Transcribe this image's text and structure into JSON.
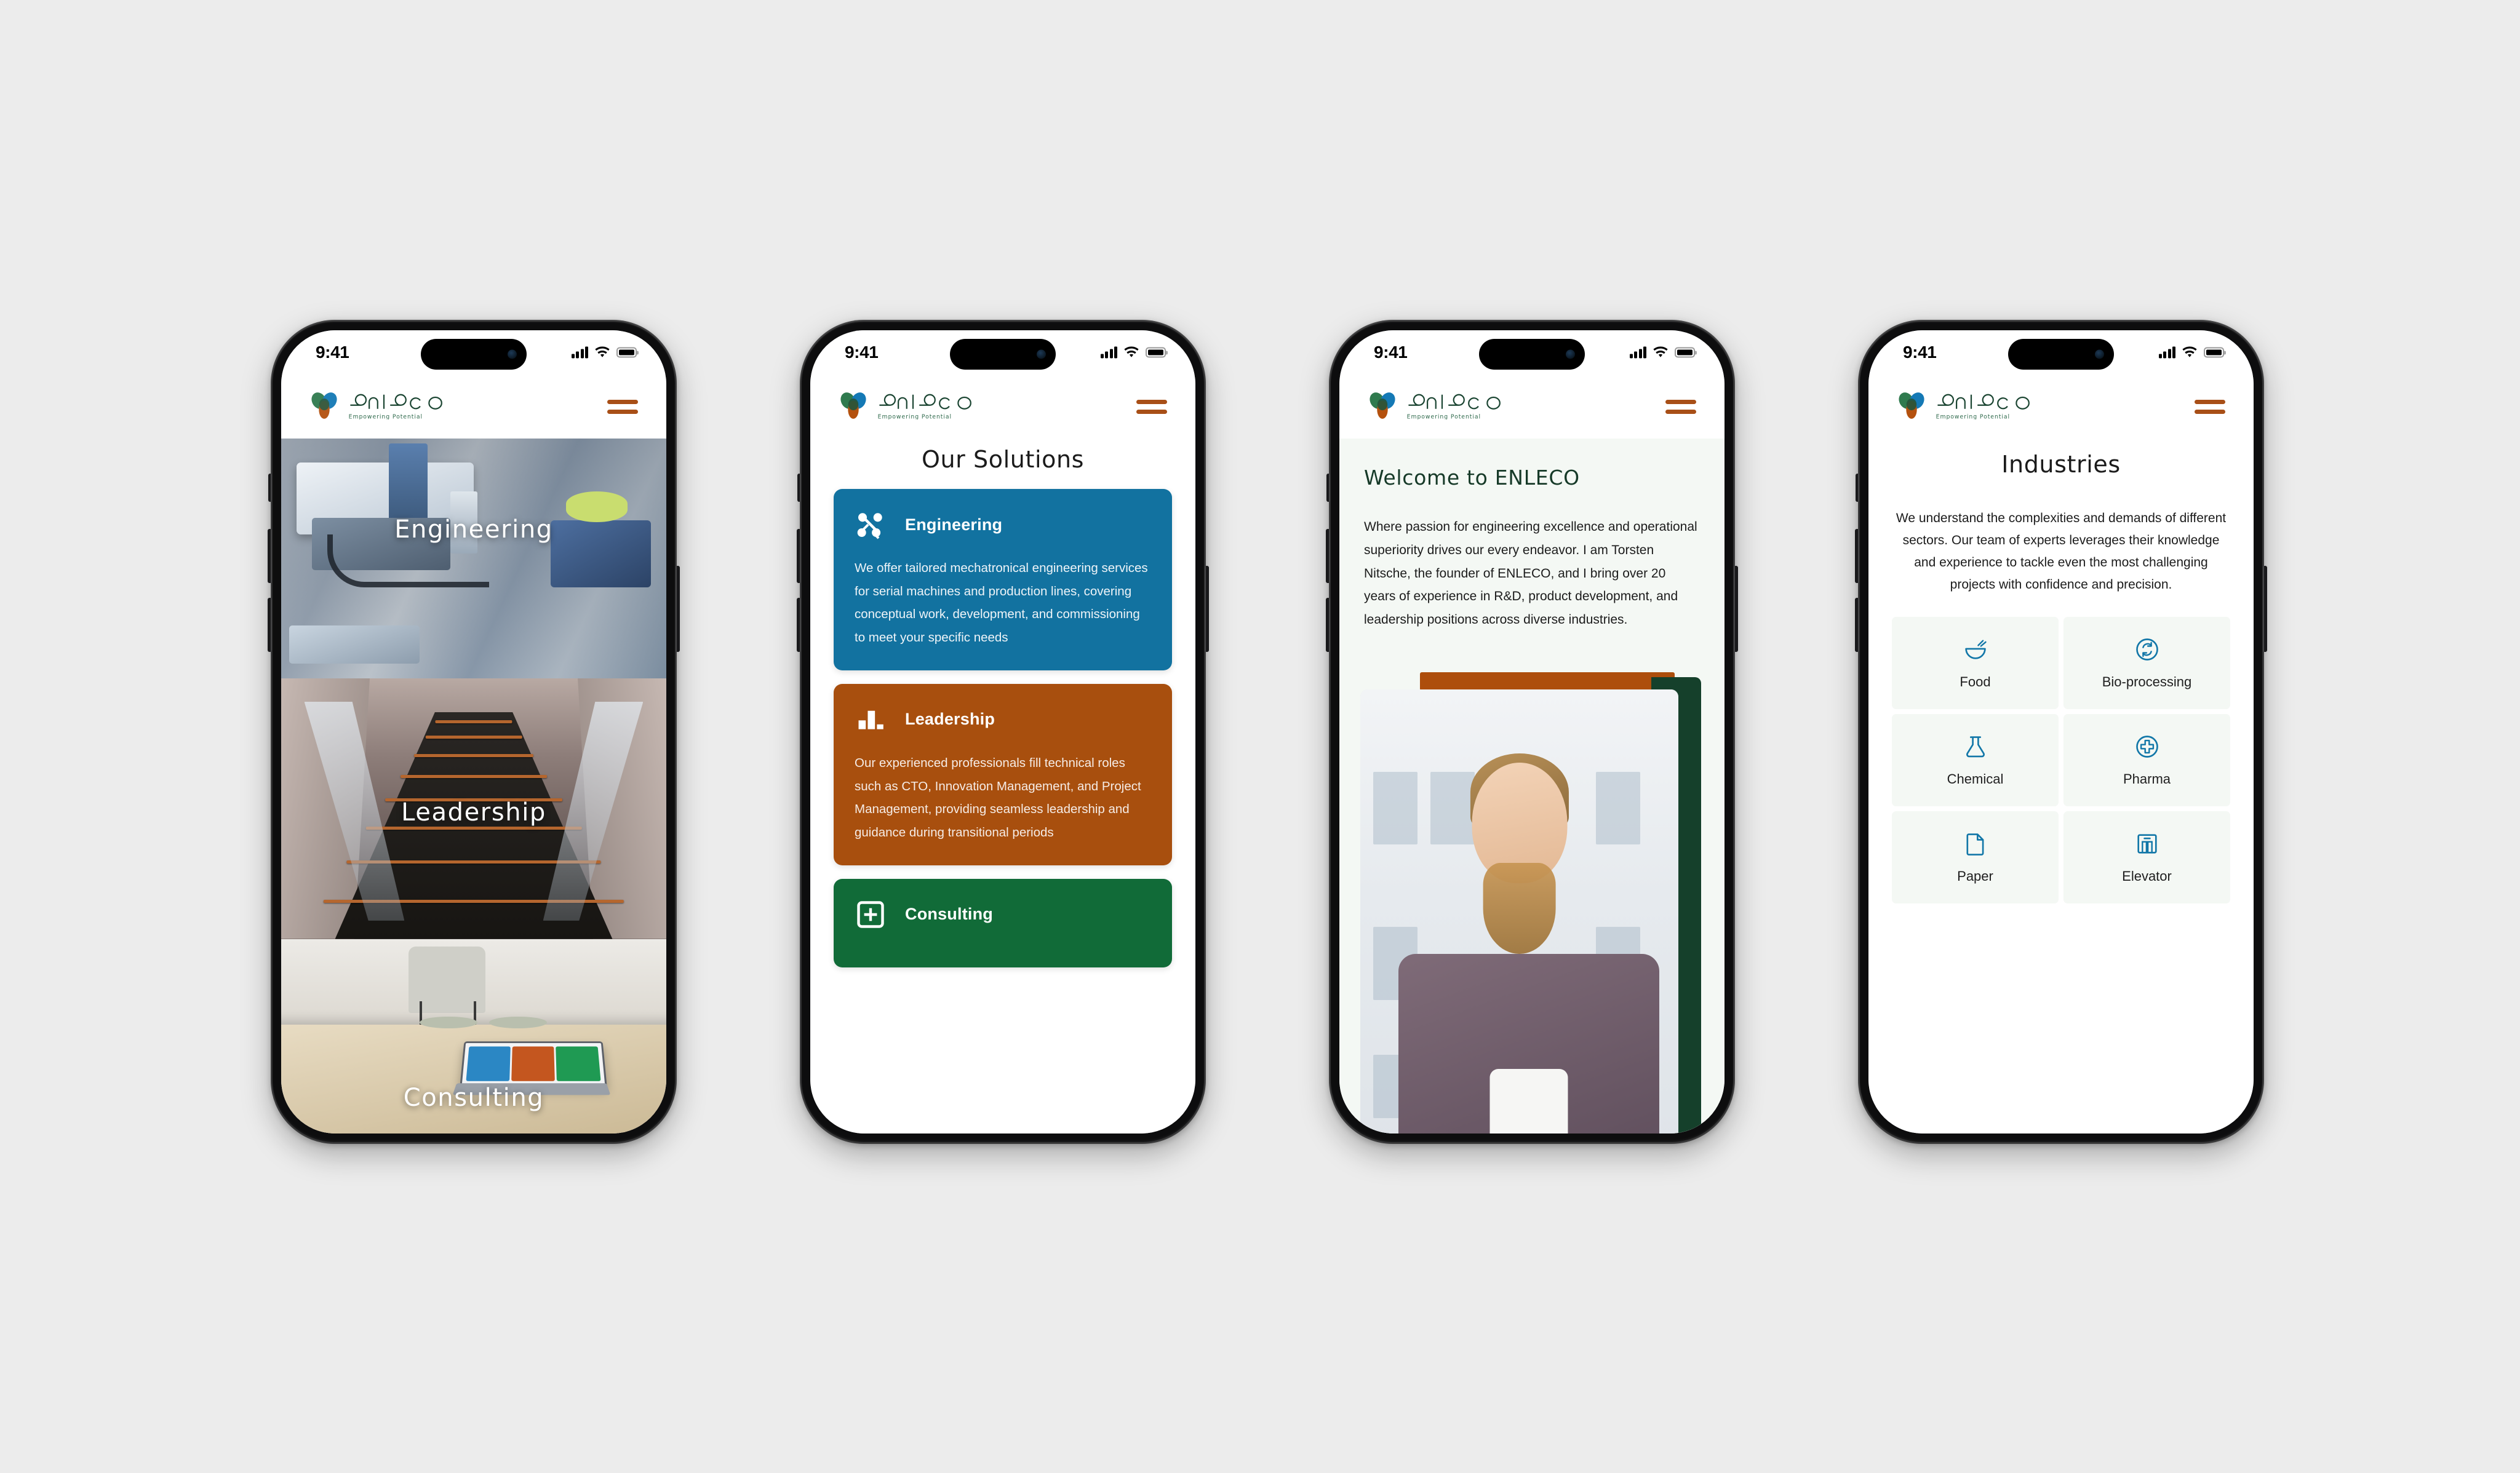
{
  "meta": {
    "background_color": "#ececec",
    "device_count": 4
  },
  "status_bar": {
    "time": "9:41",
    "signal_icon": "cellular-signal-icon",
    "wifi_icon": "wifi-icon",
    "battery_icon": "battery-icon"
  },
  "brand": {
    "name": "enleco",
    "tagline": "Empowering Potential",
    "menu_icon": "hamburger-menu-icon",
    "colors": {
      "leaf_green": "#2f7a4e",
      "leaf_blue": "#1479b5",
      "leaf_orange": "#b4510e",
      "wordmark": "#1c4633",
      "menu": "#a84f17"
    }
  },
  "screens": [
    {
      "id": "home-hero",
      "hero_panels": [
        {
          "label": "Engineering",
          "art": "lab-machinery-photo"
        },
        {
          "label": "Leadership",
          "art": "escalator-photo"
        },
        {
          "label": "Consulting",
          "art": "office-desk-tablet-photo"
        }
      ]
    },
    {
      "id": "our-solutions",
      "title": "Our Solutions",
      "cards": [
        {
          "name": "Engineering",
          "icon": "network-nodes-icon",
          "color": "#1272a0",
          "description": "We offer tailored mechatronical engineering services for serial machines and production lines, covering conceptual work, development, and commissioning to meet your specific needs"
        },
        {
          "name": "Leadership",
          "icon": "bar-chart-icon",
          "color": "#a84f0e",
          "description": "Our experienced professionals fill technical roles such as CTO, Innovation Management, and Project Management, providing seamless leadership and guidance during transitional periods"
        },
        {
          "name": "Consulting",
          "icon": "plus-square-icon",
          "color": "#116b38",
          "description": ""
        }
      ]
    },
    {
      "id": "welcome",
      "title": "Welcome to ENLECO",
      "body": "Where passion for engineering excellence and operational superiority drives our every endeavor. I am Torsten Nitsche, the founder of ENLECO, and I bring over 20 years of experience in R&D, product development, and leadership positions across diverse industries.",
      "founder_photo": "founder-portrait-photo",
      "accent_colors": {
        "orange": "#ad4e0c",
        "green": "#15402b"
      }
    },
    {
      "id": "industries",
      "title": "Industries",
      "intro": "We understand the complexities and demands of different sectors. Our team of experts leverages their knowledge and experience to tackle even the most challenging projects with confidence and precision.",
      "icon_color": "#1277a8",
      "items": [
        {
          "label": "Food",
          "icon": "bowl-steam-icon"
        },
        {
          "label": "Bio-processing",
          "icon": "recycle-circle-icon"
        },
        {
          "label": "Chemical",
          "icon": "flask-icon"
        },
        {
          "label": "Pharma",
          "icon": "medical-cross-circle-icon"
        },
        {
          "label": "Paper",
          "icon": "document-page-icon"
        },
        {
          "label": "Elevator",
          "icon": "elevator-icon"
        }
      ]
    }
  ]
}
